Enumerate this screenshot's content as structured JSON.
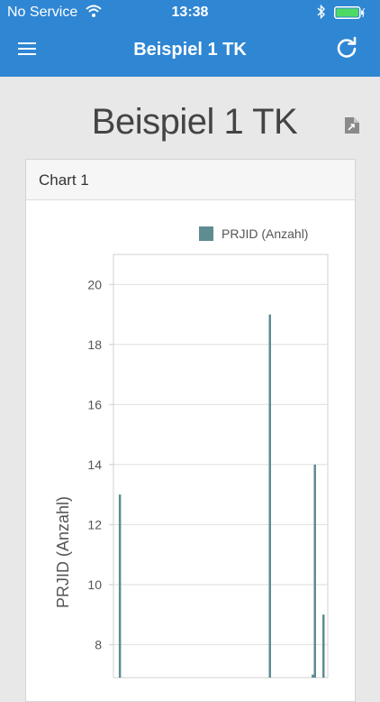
{
  "status_bar": {
    "carrier": "No Service",
    "time": "13:38"
  },
  "nav": {
    "title": "Beispiel 1 TK"
  },
  "page": {
    "title": "Beispiel 1 TK"
  },
  "card": {
    "title": "Chart 1"
  },
  "colors": {
    "nav_bg": "#2f86d3",
    "series": "#5e8c91",
    "battery": "#4cd964"
  },
  "icons": {
    "menu": "hamburger-icon",
    "refresh": "refresh-icon",
    "export": "export-icon",
    "wifi": "wifi-icon",
    "bluetooth": "bluetooth-icon",
    "battery": "battery-icon"
  },
  "chart_data": {
    "type": "bar",
    "series": [
      {
        "name": "PRJID (Anzahl)",
        "color": "#5e8c91",
        "points": [
          {
            "x": 0.03,
            "y": 13
          },
          {
            "x": 0.73,
            "y": 19
          },
          {
            "x": 0.93,
            "y": 7
          },
          {
            "x": 0.94,
            "y": 14
          },
          {
            "x": 0.98,
            "y": 9
          }
        ]
      }
    ],
    "ylabel": "PRJID (Anzahl)",
    "y_ticks": [
      8,
      10,
      12,
      14,
      16,
      18,
      20
    ],
    "ylim": [
      6.9,
      21
    ],
    "xlim": [
      0,
      1
    ],
    "grid": true,
    "legend": "top-right"
  }
}
